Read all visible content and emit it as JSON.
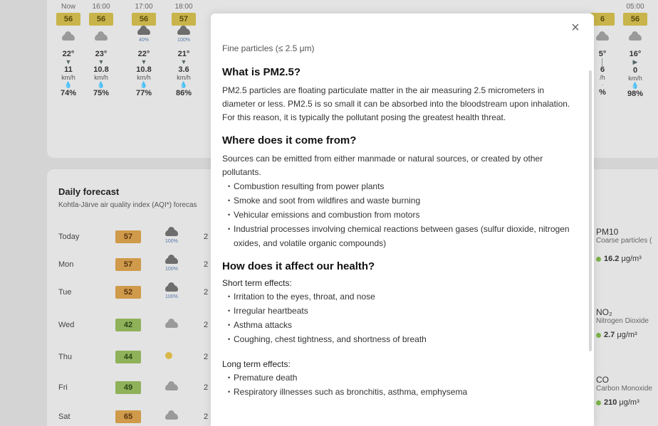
{
  "hourly": {
    "columns": [
      {
        "time": "Now",
        "aqi": "56",
        "aqi_color": "yellow",
        "icon": "cloud-icon",
        "precip": "",
        "temp": "22°",
        "wind": "11",
        "wind_unit": "km/h",
        "humidity": "74%"
      },
      {
        "time": "16:00",
        "aqi": "56",
        "aqi_color": "yellow",
        "icon": "cloud-icon",
        "precip": "",
        "temp": "23°",
        "wind": "10.8",
        "wind_unit": "km/h",
        "humidity": "75%"
      },
      {
        "time": "17:00",
        "aqi": "56",
        "aqi_color": "yellow",
        "icon": "rain-cloud-icon",
        "precip": "40%",
        "temp": "22°",
        "wind": "10.8",
        "wind_unit": "km/h",
        "humidity": "77%"
      },
      {
        "time": "18:00",
        "aqi": "57",
        "aqi_color": "yellow",
        "icon": "rain-cloud-icon",
        "precip": "100%",
        "temp": "21°",
        "wind": "3.6",
        "wind_unit": "km/h",
        "humidity": "86%"
      }
    ],
    "right_columns": [
      {
        "time": "",
        "aqi": "6",
        "aqi_color": "yellow",
        "icon": "cloud-icon",
        "temp": "5°",
        "wind": "6",
        "wind_unit": "/h",
        "humidity": "%"
      },
      {
        "time": "05:00",
        "aqi": "56",
        "aqi_color": "yellow",
        "icon": "cloud-icon",
        "temp": "16°",
        "wind": "0",
        "wind_unit": "km/h",
        "humidity": "98%"
      }
    ]
  },
  "daily": {
    "title": "Daily forecast",
    "subtitle": "Kohtla-Järve air quality index (AQI*) forecas",
    "rows": [
      {
        "day": "Today",
        "aqi": "57",
        "aqi_color": "yellow",
        "icon": "rain-cloud-icon",
        "precip": "100%",
        "temp": "2"
      },
      {
        "day": "Mon",
        "aqi": "57",
        "aqi_color": "yellow",
        "icon": "rain-cloud-icon",
        "precip": "100%",
        "temp": "2"
      },
      {
        "day": "Tue",
        "aqi": "52",
        "aqi_color": "yellow",
        "icon": "rain-cloud-icon",
        "precip": "100%",
        "temp": "2"
      },
      {
        "day": "Wed",
        "aqi": "42",
        "aqi_color": "green",
        "icon": "cloud-icon",
        "precip": "",
        "temp": "2"
      },
      {
        "day": "Thu",
        "aqi": "44",
        "aqi_color": "green",
        "icon": "sun-cloud-icon",
        "precip": "",
        "temp": "2"
      },
      {
        "day": "Fri",
        "aqi": "49",
        "aqi_color": "green",
        "icon": "cloud-icon",
        "precip": "",
        "temp": "2"
      },
      {
        "day": "Sat",
        "aqi": "65",
        "aqi_color": "yellow",
        "icon": "cloud-icon",
        "precip": "",
        "temp": "2"
      }
    ]
  },
  "pollutants": [
    {
      "name": "PM10",
      "desc": "Coarse particles (",
      "value": "16.2",
      "unit": "μg/m³"
    },
    {
      "name": "NO₂",
      "desc": "Nitrogen Dioxide",
      "value": "2.7",
      "unit": "μg/m³"
    },
    {
      "name": "CO",
      "desc": "Carbon Monoxide",
      "value": "210",
      "unit": "μg/m³"
    }
  ],
  "modal": {
    "close_label": "×",
    "subtitle": "Fine particles (≤ 2.5 μm)",
    "what_heading": "What is PM2.5?",
    "what_text": "PM2.5 particles are floating particulate matter in the air measuring 2.5 micrometers in diameter or less. PM2.5 is so small it can be absorbed into the bloodstream upon inhalation. For this reason, it is typically the pollutant posing the greatest health threat.",
    "where_heading": "Where does it come from?",
    "where_text": "Sources can be emitted from either manmade or natural sources, or created by other pollutants.",
    "sources": [
      "Combustion resulting from power plants",
      "Smoke and soot from wildfires and waste burning",
      "Vehicular emissions and combustion from motors",
      "Industrial processes involving chemical reactions between gases (sulfur dioxide, nitrogen oxides, and volatile organic compounds)"
    ],
    "health_heading": "How does it affect our health?",
    "short_term_label": "Short term effects:",
    "short_term": [
      "Irritation to the eyes, throat, and nose",
      "Irregular heartbeats",
      "Asthma attacks",
      "Coughing, chest tightness, and shortness of breath"
    ],
    "long_term_label": "Long term effects:",
    "long_term": [
      "Premature death",
      "Respiratory illnesses such as bronchitis, asthma, emphysema"
    ]
  }
}
